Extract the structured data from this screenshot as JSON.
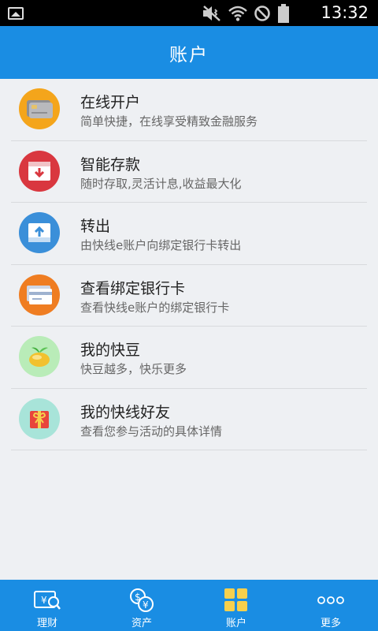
{
  "status_bar": {
    "time": "13:32"
  },
  "header": {
    "title": "账户"
  },
  "menu": [
    {
      "title": "在线开户",
      "subtitle": "简单快捷，在线享受精致金融服务",
      "icon": "card-icon",
      "color": "#f4a51b"
    },
    {
      "title": "智能存款",
      "subtitle": "随时存取,灵活计息,收益最大化",
      "icon": "deposit-icon",
      "color": "#d9373f"
    },
    {
      "title": "转出",
      "subtitle": "由快线e账户向绑定银行卡转出",
      "icon": "transfer-out-icon",
      "color": "#3a8fd9"
    },
    {
      "title": "查看绑定银行卡",
      "subtitle": "查看快线e账户的绑定银行卡",
      "icon": "bank-card-icon",
      "color": "#ef7d22"
    },
    {
      "title": "我的快豆",
      "subtitle": "快豆越多，快乐更多",
      "icon": "bean-icon",
      "color": "#b9ecb8"
    },
    {
      "title": "我的快线好友",
      "subtitle": "查看您参与活动的具体详情",
      "icon": "gift-icon",
      "color": "#a8e4d9"
    }
  ],
  "bottom_nav": [
    {
      "label": "理财",
      "icon": "finance-icon"
    },
    {
      "label": "资产",
      "icon": "assets-icon"
    },
    {
      "label": "账户",
      "icon": "account-grid-icon",
      "active": true
    },
    {
      "label": "更多",
      "icon": "more-icon"
    }
  ]
}
